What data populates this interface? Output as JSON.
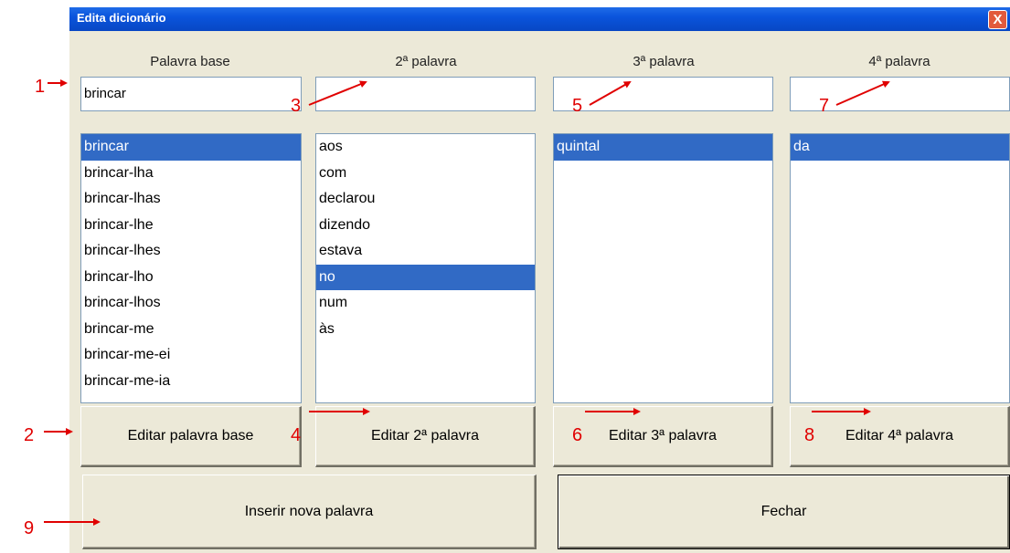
{
  "window": {
    "title": "Edita dicionário",
    "close_label": "X"
  },
  "columns": {
    "base": {
      "label": "Palavra base",
      "value": "brincar",
      "items": [
        "brincar",
        "brincar-lha",
        "brincar-lhas",
        "brincar-lhe",
        "brincar-lhes",
        "brincar-lho",
        "brincar-lhos",
        "brincar-me",
        "brincar-me-ei",
        "brincar-me-ia"
      ],
      "selected_index": 0,
      "button": "Editar palavra base"
    },
    "second": {
      "label": "2ª palavra",
      "value": "",
      "items": [
        "aos",
        "com",
        "declarou",
        "dizendo",
        "estava",
        "no",
        "num",
        "às"
      ],
      "selected_index": 5,
      "button": "Editar 2ª palavra"
    },
    "third": {
      "label": "3ª palavra",
      "value": "",
      "items": [
        "quintal"
      ],
      "selected_index": 0,
      "button": "Editar 3ª palavra"
    },
    "fourth": {
      "label": "4ª palavra",
      "value": "",
      "items": [
        "da"
      ],
      "selected_index": 0,
      "button": "Editar 4ª palavra"
    }
  },
  "actions": {
    "insert": "Inserir nova palavra",
    "close": "Fechar"
  },
  "annotations": {
    "n1": "1",
    "n2": "2",
    "n3": "3",
    "n4": "4",
    "n5": "5",
    "n6": "6",
    "n7": "7",
    "n8": "8",
    "n9": "9"
  },
  "annotation_color": "#e00000",
  "selection_color": "#316ac5"
}
